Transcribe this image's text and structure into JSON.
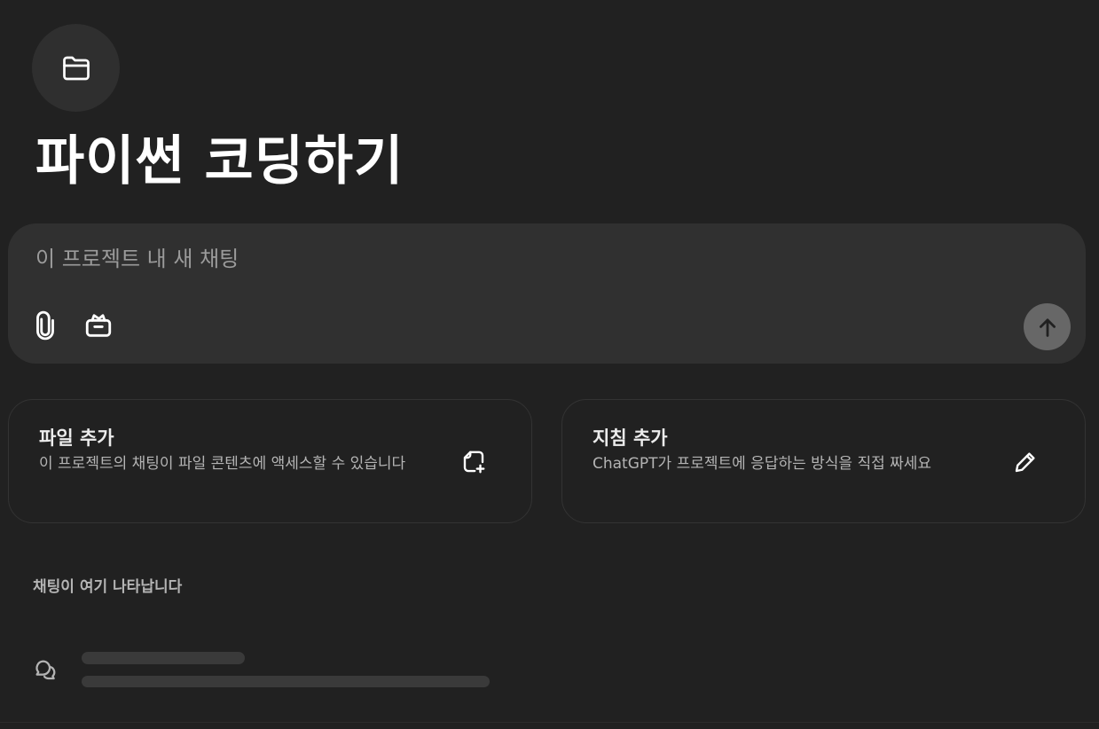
{
  "project": {
    "icon": "folder-icon",
    "title": "파이썬 코딩하기"
  },
  "composer": {
    "placeholder": "이 프로젝트 내 새 채팅",
    "value": "",
    "attach_icon": "paperclip-icon",
    "tools_icon": "toolbox-icon",
    "send_icon": "arrow-up-icon"
  },
  "cards": {
    "files": {
      "title": "파일 추가",
      "description": "이 프로젝트의 채팅이 파일 콘텐츠에 액세스할 수 있습니다",
      "icon": "add-file-icon"
    },
    "instructions": {
      "title": "지침 추가",
      "description": "ChatGPT가 프로젝트에 응답하는 방식을 직접 짜세요",
      "icon": "pencil-icon"
    }
  },
  "chats": {
    "empty_label": "채팅이 여기 나타납니다",
    "placeholder_icon": "chat-bubbles-icon"
  },
  "colors": {
    "background": "#212121",
    "surface": "#303030",
    "send_button": "#676767",
    "skeleton": "#3a3a3a"
  }
}
